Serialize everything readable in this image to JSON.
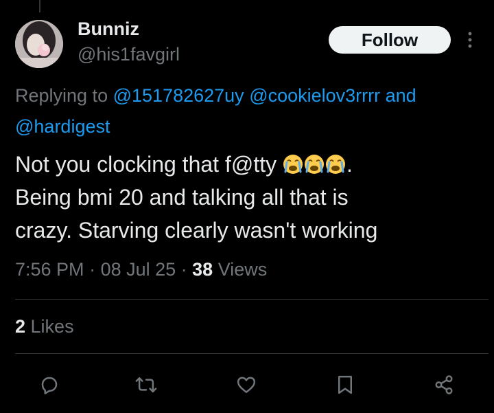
{
  "tweet": {
    "author": {
      "display_name": "Bunniz",
      "handle": "@his1favgirl"
    },
    "follow_label": "Follow",
    "reply_context": {
      "prefix": "Replying to ",
      "mention_1": "@151782627uy",
      "mention_2": "@cookielov3rrrr",
      "conjunction": " and ",
      "mention_3": "@hardigest"
    },
    "text": {
      "line1": "Not you clocking that f@tty ",
      "line1_end": ".",
      "line2": "Being bmi 20 and talking all that is",
      "line3": "crazy. Starving clearly wasn't working",
      "emoji_name": "loudly-crying-face",
      "emoji_count": 3
    },
    "meta": {
      "time": "7:56 PM",
      "separator": " · ",
      "date": "08 Jul 25",
      "views_count": "38",
      "views_label": " Views"
    },
    "likes": {
      "count": "2",
      "label": " Likes"
    }
  },
  "colors": {
    "background": "#000000",
    "text_primary": "#e7e9ea",
    "text_secondary": "#71767b",
    "link": "#1d9bf0",
    "follow_button_bg": "#eff3f4",
    "divider": "#2f3336"
  },
  "actions": [
    {
      "icon": "reply-icon"
    },
    {
      "icon": "retweet-icon"
    },
    {
      "icon": "like-icon"
    },
    {
      "icon": "bookmark-icon"
    },
    {
      "icon": "share-icon"
    }
  ]
}
